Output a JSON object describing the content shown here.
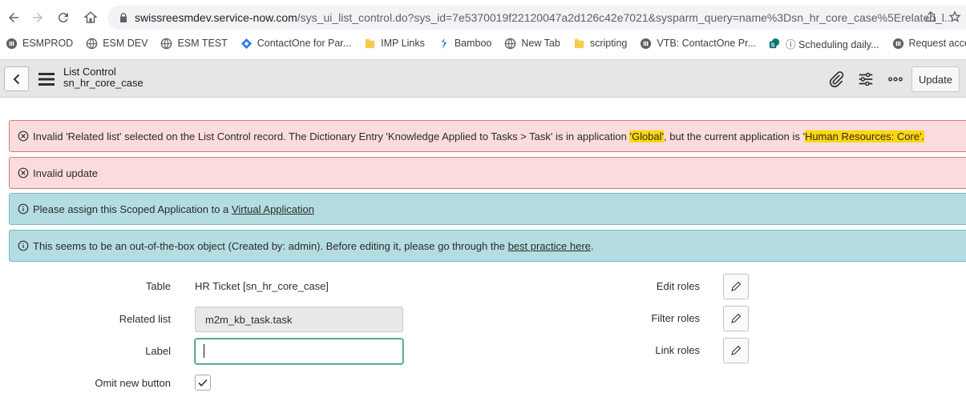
{
  "browser": {
    "url_host": "swissreesmdev.service-now.com",
    "url_rest": "/sys_ui_list_control.do?sys_id=7e5370019f22120047a2d126c42e7021&sysparm_query=name%3Dsn_hr_core_case%5Erelated_l..."
  },
  "bookmarks": [
    {
      "label": "ESMPROD",
      "icon": "servicenow-icon"
    },
    {
      "label": "ESM DEV",
      "icon": "globe-icon"
    },
    {
      "label": "ESM TEST",
      "icon": "globe-icon"
    },
    {
      "label": "ContactOne for Par...",
      "icon": "diamond-icon"
    },
    {
      "label": "IMP Links",
      "icon": "folder-icon"
    },
    {
      "label": "Bamboo",
      "icon": "bamboo-icon"
    },
    {
      "label": "New Tab",
      "icon": "globe-icon"
    },
    {
      "label": "scripting",
      "icon": "folder-icon"
    },
    {
      "label": "VTB: ContactOne Pr...",
      "icon": "servicenow-icon"
    },
    {
      "label": "ⓘ Scheduling daily...",
      "icon": "sharepoint-icon"
    },
    {
      "label": "Request access rig",
      "icon": "servicenow-icon"
    }
  ],
  "header": {
    "title": "List Control",
    "subtitle": "sn_hr_core_case",
    "update_label": "Update"
  },
  "messages": {
    "error1_a": "Invalid 'Related list' selected on the List Control record. The Dictionary Entry 'Knowledge Applied to Tasks > Task' is in application ",
    "error1_hl1": "'Global'",
    "error1_b": ", but the current application is '",
    "error1_hl2": "Human Resources: Core'.",
    "error2": "Invalid update",
    "info1_a": "Please assign this Scoped Application to a ",
    "info1_link": "Virtual Application",
    "info2_a": "This seems to be an out-of-the-box object (Created by: admin). Before editing it, please go through the ",
    "info2_link": "best practice here",
    "info2_b": "."
  },
  "form": {
    "table_label": "Table",
    "table_value": "HR Ticket [sn_hr_core_case]",
    "related_label": "Related list",
    "related_value": "m2m_kb_task.task",
    "label_label": "Label",
    "label_value": "",
    "omit_label": "Omit new button",
    "omit_checked": true,
    "edit_roles_label": "Edit roles",
    "filter_roles_label": "Filter roles",
    "link_roles_label": "Link roles"
  },
  "colors": {
    "error_bg": "#fadcdc",
    "info_bg": "#b4dde2",
    "highlight": "#ffd60a",
    "header_bg": "#e4e6e7"
  }
}
